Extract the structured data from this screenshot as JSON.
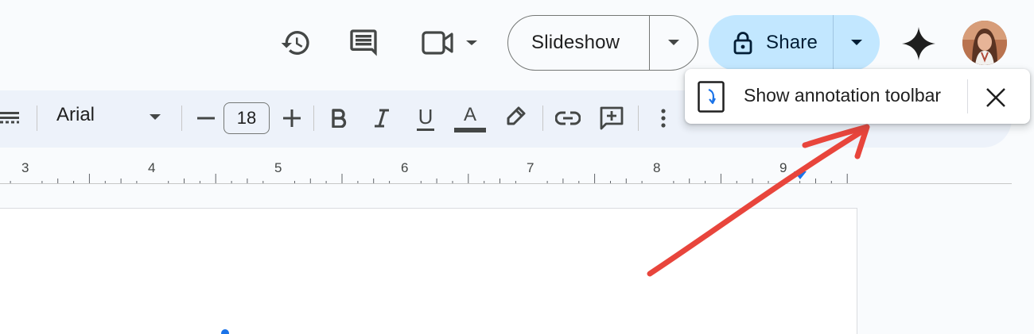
{
  "header": {
    "slideshow_label": "Slideshow",
    "share_label": "Share",
    "icons": [
      "version-history-icon",
      "comments-icon",
      "meet-video-icon",
      "gemini-sparkle-icon"
    ]
  },
  "toolbar": {
    "font_name": "Arial",
    "font_size": "18",
    "underline_letter": "U",
    "text_color_letter": "A"
  },
  "ruler": {
    "marks": [
      "3",
      "4",
      "5",
      "6",
      "7",
      "8",
      "9"
    ]
  },
  "popup": {
    "label": "Show annotation toolbar"
  },
  "colors": {
    "share_bg": "#c2e7ff",
    "toolbar_bg": "#edf2fa",
    "annotation_arrow": "#e8453c",
    "ruler_marker": "#1a73e8"
  }
}
